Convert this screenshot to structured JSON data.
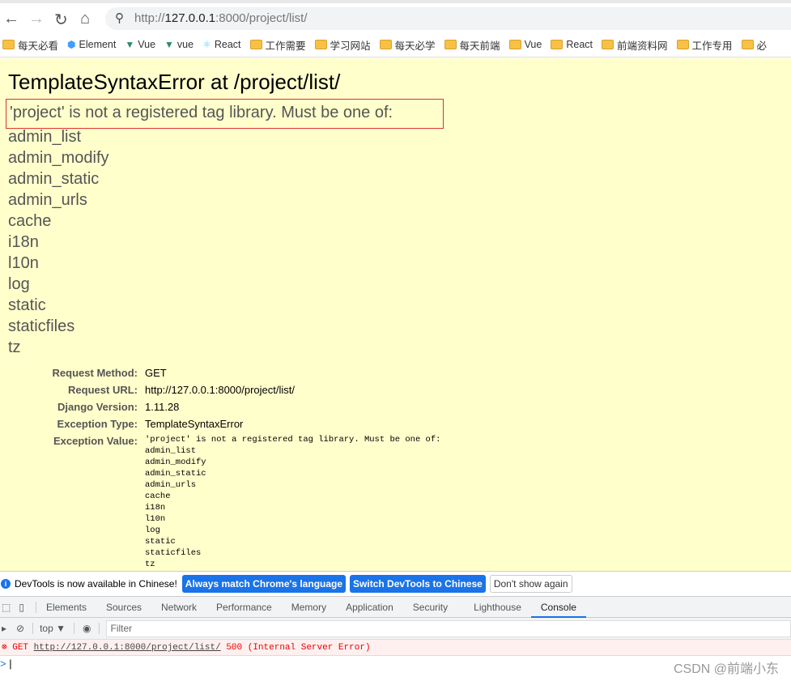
{
  "browser": {
    "url_scheme": "http://",
    "url_host": "127.0.0.1",
    "url_rest": ":8000/project/list/"
  },
  "bookmarks": [
    {
      "label": "每天必看",
      "icon": "folder"
    },
    {
      "label": "Element",
      "icon": "element-logo"
    },
    {
      "label": "Vue",
      "icon": "vue-logo"
    },
    {
      "label": "vue",
      "icon": "vue-logo"
    },
    {
      "label": "React",
      "icon": "react-logo"
    },
    {
      "label": "工作需要",
      "icon": "folder"
    },
    {
      "label": "学习网站",
      "icon": "folder"
    },
    {
      "label": "每天必学",
      "icon": "folder"
    },
    {
      "label": "每天前端",
      "icon": "folder"
    },
    {
      "label": "Vue",
      "icon": "folder"
    },
    {
      "label": "React",
      "icon": "folder"
    },
    {
      "label": "前端资料网",
      "icon": "folder"
    },
    {
      "label": "工作专用",
      "icon": "folder"
    },
    {
      "label": "必",
      "icon": "folder"
    }
  ],
  "error": {
    "title": "TemplateSyntaxError at /project/list/",
    "summary": "'project' is not a registered tag library. Must be one of:",
    "libraries": [
      "admin_list",
      "admin_modify",
      "admin_static",
      "admin_urls",
      "cache",
      "i18n",
      "l10n",
      "log",
      "static",
      "staticfiles",
      "tz"
    ],
    "meta": [
      {
        "k": "Request Method:",
        "v": "GET"
      },
      {
        "k": "Request URL:",
        "v": "http://127.0.0.1:8000/project/list/"
      },
      {
        "k": "Django Version:",
        "v": "1.11.28"
      },
      {
        "k": "Exception Type:",
        "v": "TemplateSyntaxError"
      },
      {
        "k": "Exception Value:",
        "v": ""
      }
    ],
    "exception_value": "'project' is not a registered tag library. Must be one of:\nadmin_list\nadmin_modify\nadmin_static\nadmin_urls\ncache\ni18n\nl10n\nlog\nstatic\nstaticfiles\ntz"
  },
  "devtools": {
    "info": "DevTools is now available in Chinese!",
    "btn1": "Always match Chrome's language",
    "btn2": "Switch DevTools to Chinese",
    "btn3": "Don't show again",
    "tabs": [
      "Elements",
      "Sources",
      "Network",
      "Performance",
      "Memory",
      "Application",
      "Security",
      "Lighthouse",
      "Console"
    ],
    "active_tab": "Console",
    "context": "top ▼",
    "filter_placeholder": "Filter",
    "err_method": "GET",
    "err_url": "http://127.0.0.1:8000/project/list/",
    "err_status": "500 (Internal Server Error)"
  },
  "watermark": "CSDN @前端小东"
}
